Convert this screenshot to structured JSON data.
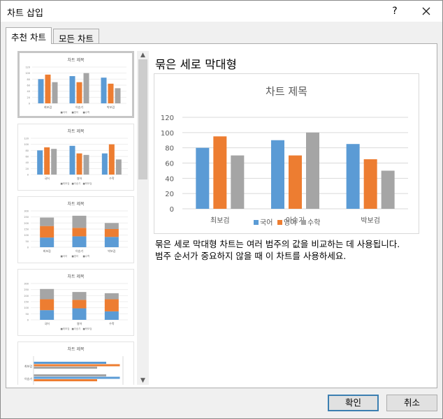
{
  "window": {
    "title": "차트 삽입",
    "help_glyph": "?"
  },
  "tabs": [
    {
      "label": "추천 차트",
      "active": true
    },
    {
      "label": "모든 차트",
      "active": false
    }
  ],
  "selected_chart": {
    "name": "묶은 세로 막대형",
    "description": [
      "묶은 세로 막대형 차트는 여러 범주의 값을 비교하는 데 사용됩니다.",
      "범주 순서가 중요하지 않을 때 이 차트를 사용하세요."
    ]
  },
  "thumbnails": {
    "title": "차트 제목",
    "items": [
      {
        "kind": "clustered",
        "selected": true,
        "categories": [
          "최보검",
          "이승기",
          "박보검"
        ],
        "legend": [
          "■국어",
          "■영어",
          "■수학"
        ],
        "ticks": [
          "120",
          "100",
          "80",
          "60",
          "40",
          "20",
          "0"
        ]
      },
      {
        "kind": "clustered-transposed",
        "selected": false,
        "categories": [
          "국어",
          "영어",
          "수학"
        ],
        "legend": [
          "■최보검",
          "■이승기",
          "■박보검"
        ],
        "ticks": [
          "120",
          "100",
          "80",
          "60",
          "40",
          "20",
          "0"
        ]
      },
      {
        "kind": "stacked",
        "selected": false,
        "categories": [
          "최보검",
          "이승기",
          "박보검"
        ],
        "legend": [
          "■국어",
          "■영어",
          "■수학"
        ],
        "ticks": [
          "300",
          "250",
          "200",
          "150",
          "100",
          "50",
          "0"
        ]
      },
      {
        "kind": "stacked-transposed",
        "selected": false,
        "categories": [
          "국어",
          "영어",
          "수학"
        ],
        "legend": [
          "■최보검",
          "■이승기",
          "■박보검"
        ],
        "ticks": [
          "300",
          "250",
          "200",
          "150",
          "100",
          "50",
          "0"
        ]
      },
      {
        "kind": "bar-horizontal",
        "selected": false,
        "categories": [
          "최보검",
          "이승기"
        ],
        "legend": [],
        "ticks": []
      }
    ]
  },
  "chart_data": {
    "type": "bar",
    "title": "차트 제목",
    "categories": [
      "최보검",
      "이승기",
      "박보검"
    ],
    "series": [
      {
        "name": "국어",
        "values": [
          80,
          90,
          85
        ],
        "color": "#5b9bd5"
      },
      {
        "name": "영어",
        "values": [
          95,
          70,
          65
        ],
        "color": "#ed7d31"
      },
      {
        "name": "수학",
        "values": [
          70,
          100,
          50
        ],
        "color": "#a5a5a5"
      }
    ],
    "ylim": [
      0,
      120
    ],
    "yticks": [
      "0",
      "20",
      "40",
      "60",
      "80",
      "100",
      "120"
    ],
    "grid": true,
    "legend": "bottom"
  },
  "buttons": {
    "ok": "확인",
    "cancel": "취소"
  }
}
